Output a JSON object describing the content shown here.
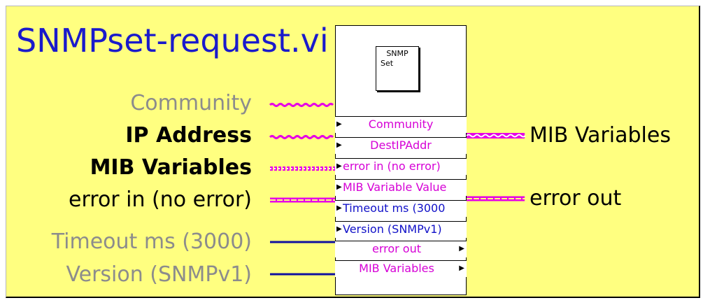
{
  "vi_name": "SNMPset-request.vi",
  "icon": {
    "line1": "SNMP",
    "line2": "Set",
    "name": "snmp-set-icon"
  },
  "inputs": [
    {
      "label": "Community",
      "status": "recommended",
      "wire": "string"
    },
    {
      "label": "IP Address",
      "status": "required",
      "wire": "string"
    },
    {
      "label": "MIB Variables",
      "status": "required",
      "wire": "cluster"
    },
    {
      "label": "error in (no error)",
      "status": "normal",
      "wire": "error"
    },
    {
      "label": "Timeout ms (3000)",
      "status": "optional",
      "wire": "numeric"
    },
    {
      "label": "Version (SNMPv1)",
      "status": "optional",
      "wire": "numeric"
    }
  ],
  "outputs": [
    {
      "label": "MIB Variables",
      "wire": "array"
    },
    {
      "label": "error out",
      "wire": "error"
    }
  ],
  "terminals": [
    {
      "label": "Community",
      "dir": "in",
      "color": "magenta"
    },
    {
      "label": "DestIPAddr",
      "dir": "in",
      "color": "magenta"
    },
    {
      "label": "error in (no error)",
      "dir": "in",
      "color": "magenta"
    },
    {
      "label": "MIB Variable Value",
      "dir": "in",
      "color": "magenta"
    },
    {
      "label": "Timeout ms (3000",
      "dir": "in",
      "color": "blue"
    },
    {
      "label": "Version (SNMPv1)",
      "dir": "in",
      "color": "blue"
    },
    {
      "label": "error out",
      "dir": "out",
      "color": "magenta"
    },
    {
      "label": "MIB Variables",
      "dir": "out",
      "color": "magenta"
    }
  ],
  "colors": {
    "background": "#ffff80",
    "title": "#1a1acb",
    "string_wire": "#e600e6",
    "numeric_wire": "#1010a0"
  }
}
